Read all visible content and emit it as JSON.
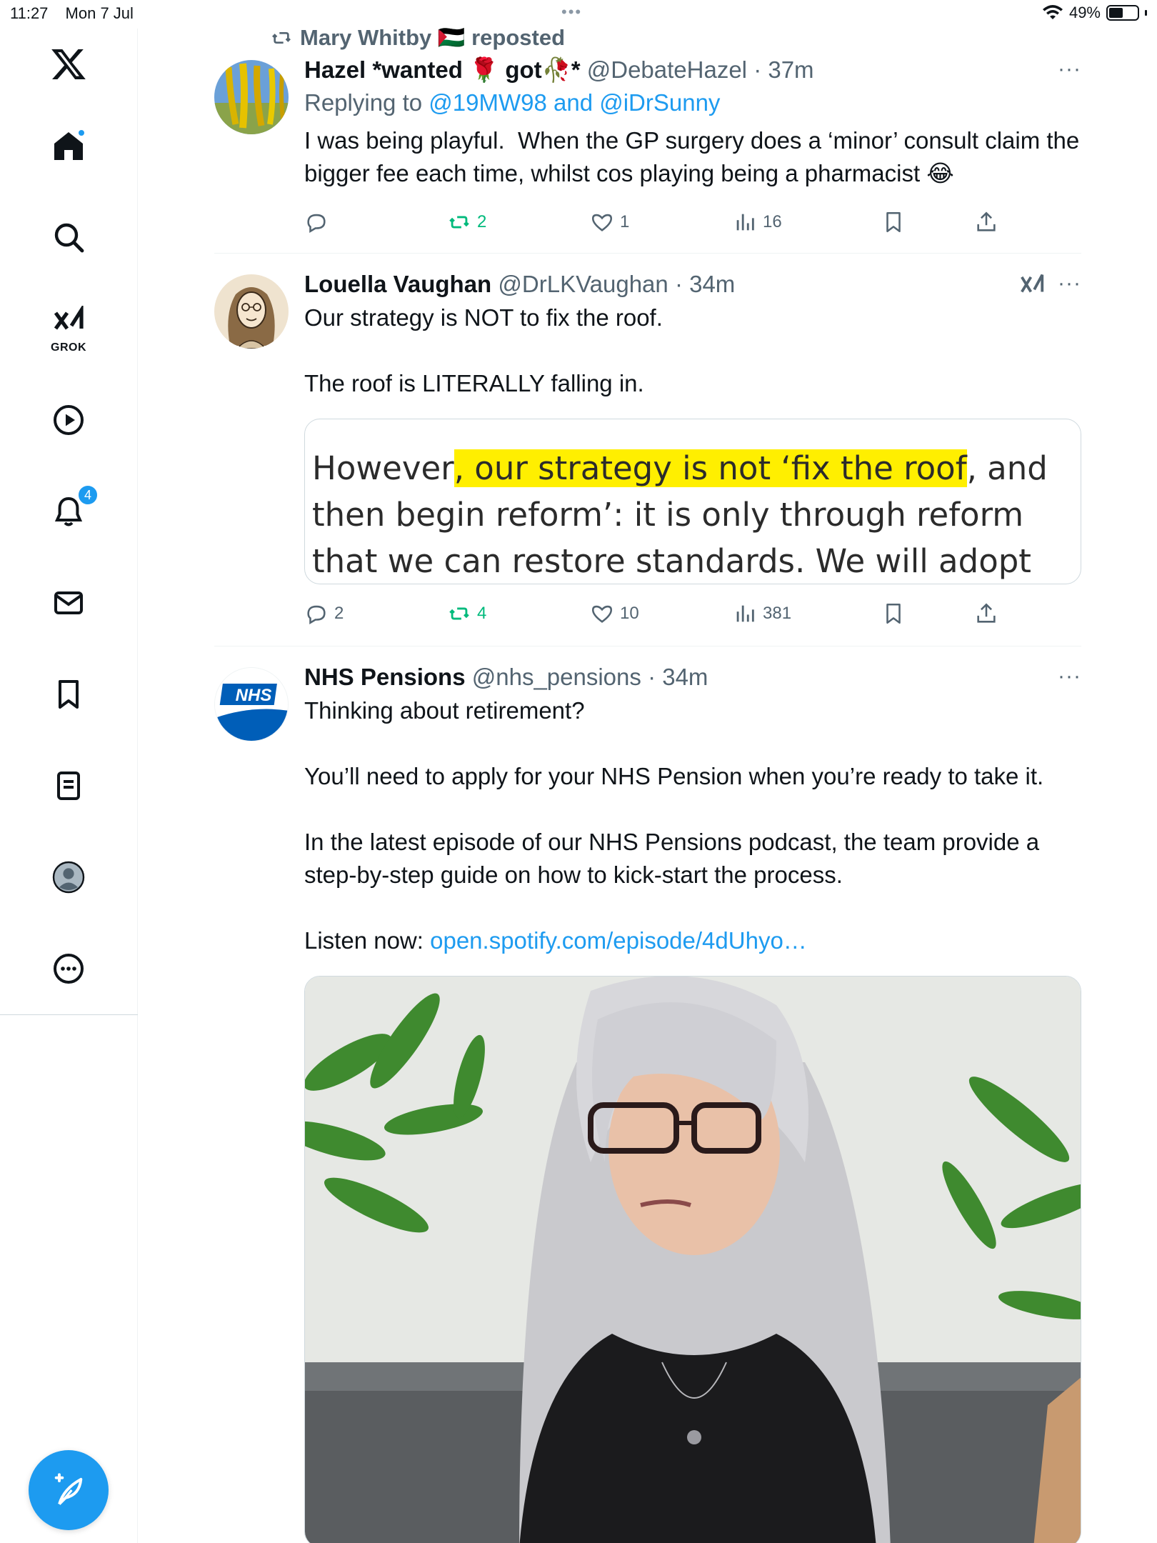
{
  "status_bar": {
    "time": "11:27",
    "date": "Mon 7 Jul",
    "multitask_dots": "•••",
    "battery": "49%"
  },
  "sidebar": {
    "grok_label": "GROK",
    "notification_count": "4"
  },
  "tweets": [
    {
      "repost_by": "Mary Whitby 🇵🇸 reposted",
      "name": "Hazel *wanted 🌹 got🥀*",
      "handle": "@DebateHazel",
      "time": "· 37m",
      "replying_prefix": "Replying to ",
      "replying_to": "@19MW98 and @iDrSunny",
      "text": "I was being playful.  When the GP surgery does a ‘minor’ consult claim the bigger fee each time, whilst cos playing being a pharmacist 😂",
      "more": "···",
      "replies": "",
      "reposts": "2",
      "likes": "1",
      "views": "16"
    },
    {
      "name": "Louella Vaughan",
      "handle": "@DrLKVaughan",
      "time": "· 34m",
      "more": "···",
      "text": "Our strategy is NOT to fix the roof.\n\nThe roof is LITERALLY falling in.",
      "quote_line1_pre": "However",
      "quote_line1_hl": ", our strategy is not ‘fix the roof",
      "quote_line1_post": ", and",
      "quote_line2": "then begin reform’: it is only through reform",
      "quote_line3": "that we can restore standards. We will adopt",
      "replies": "2",
      "reposts": "4",
      "likes": "10",
      "views": "381"
    },
    {
      "name": "NHS Pensions",
      "handle": "@nhs_pensions",
      "time": "· 34m",
      "more": "···",
      "avatar_text": "NHS",
      "text": "Thinking about retirement?\n\nYou’ll need to apply for your NHS Pension when you’re ready to take it.\n\nIn the latest episode of our NHS Pensions podcast, the team provide a step-by-step guide on how to kick-start the process.\n\n",
      "listen_prefix": "Listen now: ",
      "listen_link": "open.spotify.com/episode/4dUhyo…"
    }
  ],
  "colors": {
    "accent": "#1d9bf0",
    "repost_green": "#00ba7c",
    "secondary_text": "#536471",
    "highlight": "#ffef00"
  }
}
